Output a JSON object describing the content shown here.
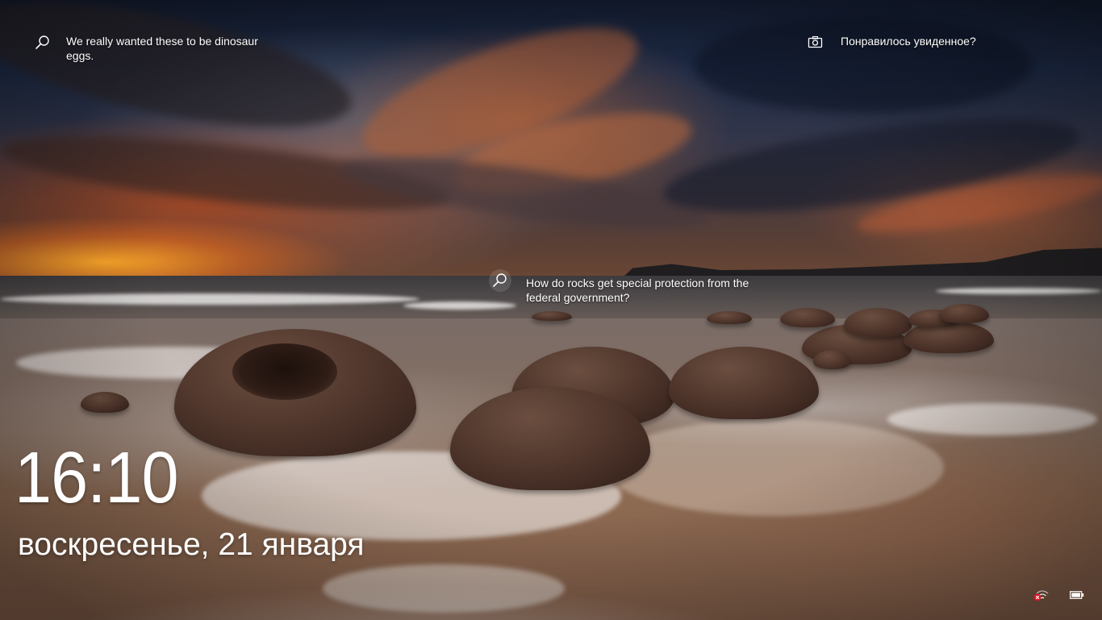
{
  "lockscreen": {
    "hotspots": [
      {
        "text": "We really wanted these to be dinosaur eggs.",
        "icon": "search-icon"
      },
      {
        "text": "How do rocks get special protection from the federal government?",
        "icon": "search-icon"
      }
    ],
    "feedback": {
      "text": "Понравилось увиденное?",
      "icon": "camera-icon"
    },
    "time": "16:10",
    "date": "воскресенье, 21 января",
    "status": {
      "network_icon": "network-disconnected-icon",
      "battery_icon": "battery-icon",
      "network_error_color": "#e81123"
    }
  }
}
